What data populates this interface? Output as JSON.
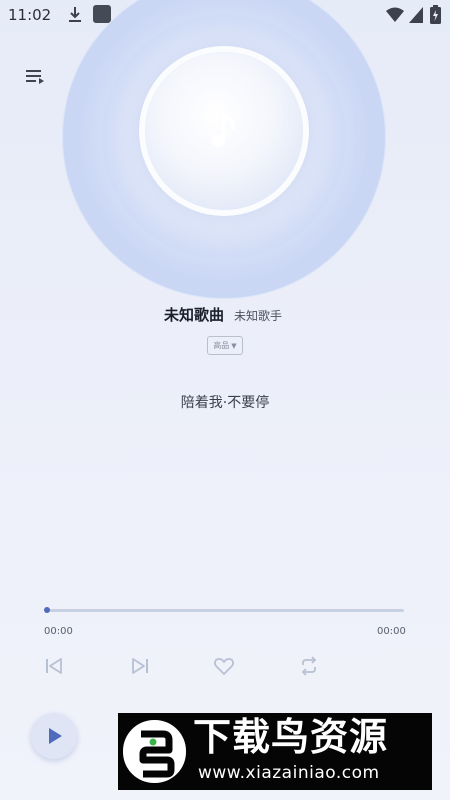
{
  "status_bar": {
    "time": "11:02"
  },
  "now_playing": {
    "title": "未知歌曲",
    "artist": "未知歌手",
    "quality": "高品",
    "lyric": "陪着我·不要停"
  },
  "progress": {
    "current": "00:00",
    "total": "00:00",
    "fraction": 0.0
  },
  "controls": [
    "previous-icon",
    "next-icon",
    "heart-icon",
    "repeat-icon"
  ],
  "watermark": {
    "title": "下载鸟资源",
    "url": "www.xiazainiao.com"
  },
  "colors": {
    "accent": "#4f6bbb",
    "icon": "#b8c0d4"
  }
}
